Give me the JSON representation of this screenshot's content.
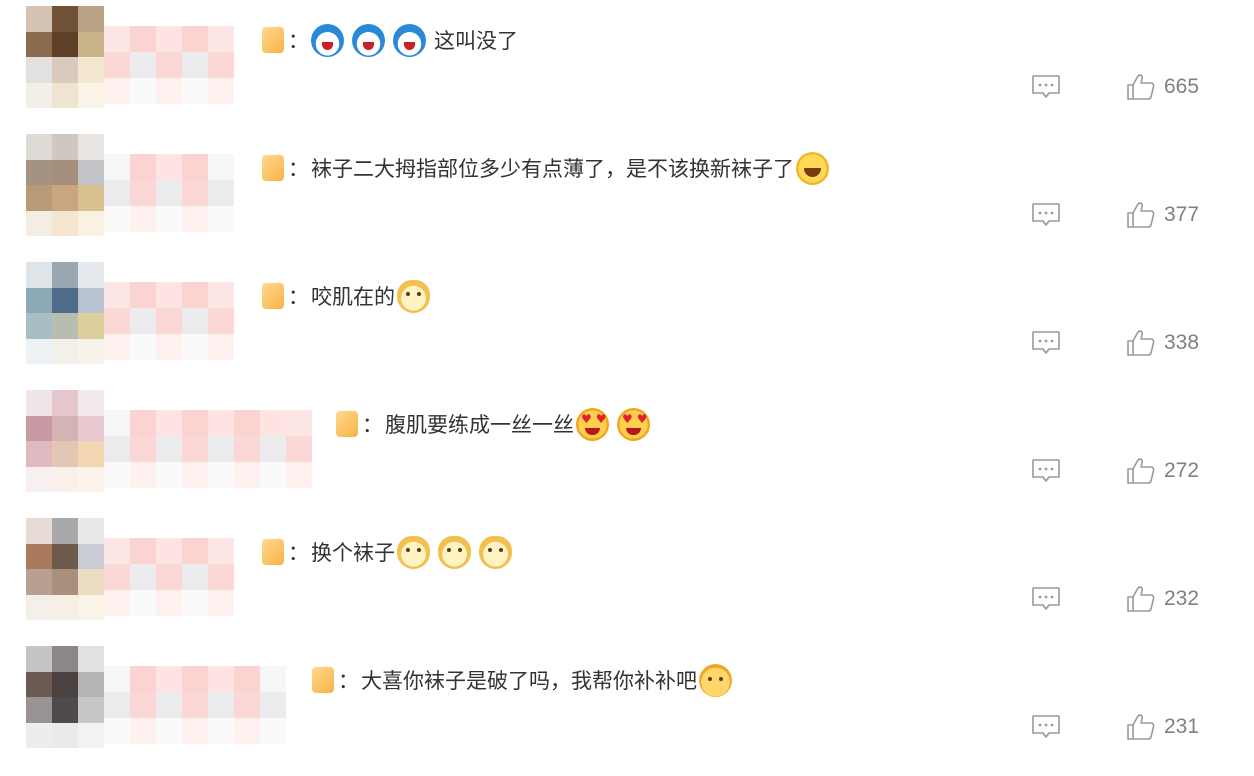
{
  "icons": {
    "reply": "comment-bubble-icon",
    "like": "thumbs-up-icon"
  },
  "colors": {
    "text": "#333333",
    "icon": "#9a9a9a",
    "count": "#808080",
    "background": "#ffffff"
  },
  "comments": [
    {
      "emojis_before": [
        "doraemon",
        "doraemon",
        "doraemon"
      ],
      "text": "这叫没了",
      "emojis_after": [],
      "likes": "665",
      "badge": true,
      "badge_offset": 0
    },
    {
      "emojis_before": [],
      "text": "袜子二大拇指部位多少有点薄了，是不该换新袜子了",
      "emojis_after": [
        "laugh"
      ],
      "likes": "377",
      "badge": true,
      "badge_offset": 0
    },
    {
      "emojis_before": [],
      "text": "咬肌在的",
      "emojis_after": [
        "doge"
      ],
      "likes": "338",
      "badge": true,
      "badge_offset": 0
    },
    {
      "emojis_before": [],
      "text": "腹肌要练成一丝一丝",
      "emojis_after": [
        "hearteyes",
        "hearteyes"
      ],
      "likes": "272",
      "badge": true,
      "badge_offset": 1
    },
    {
      "emojis_before": [],
      "text": "换个袜子",
      "emojis_after": [
        "doge",
        "doge",
        "doge"
      ],
      "likes": "232",
      "badge": true,
      "badge_offset": 0
    },
    {
      "emojis_before": [],
      "text": "大喜你袜子是破了吗，我帮你补补吧",
      "emojis_after": [
        "sly"
      ],
      "likes": "231",
      "badge": true,
      "badge_offset": 1
    }
  ]
}
